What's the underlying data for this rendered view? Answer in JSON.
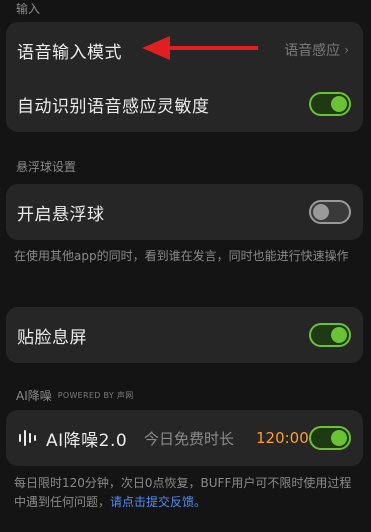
{
  "sections": {
    "input": "输入",
    "floating_ball": "悬浮球设置",
    "ai_noise": "AI降噪",
    "powered_by": "POWERED BY 声网"
  },
  "input_card": {
    "voice_mode_label": "语音输入模式",
    "voice_mode_value": "语音感应",
    "auto_sensitivity_label": "自动识别语音感应灵敏度",
    "auto_sensitivity_on": true
  },
  "floating_card": {
    "enable_label": "开启悬浮球",
    "enable_on": false,
    "description": "在使用其他app的同时，看到谁在发言，同时也能进行快速操作"
  },
  "face_card": {
    "label": "贴脸息屏",
    "on": true
  },
  "ai_card": {
    "label": "AI降噪2.0",
    "free_time_label": "今日免费时长",
    "free_time_value": "120:00",
    "on": true,
    "description": "每日限时120分钟，次日0点恢复，BUFF用户可不限时使用过程中遇到任何问题，",
    "link": "请点击提交反馈。"
  },
  "colors": {
    "accent_green": "#6cc235",
    "timer_orange": "#ff9d2e",
    "link_blue": "#4f8ef7",
    "arrow_red": "#e02020"
  },
  "icons": {
    "chevron": "chevron-right-icon",
    "noise": "sound-wave-icon",
    "annotation": "red-arrow-icon"
  }
}
